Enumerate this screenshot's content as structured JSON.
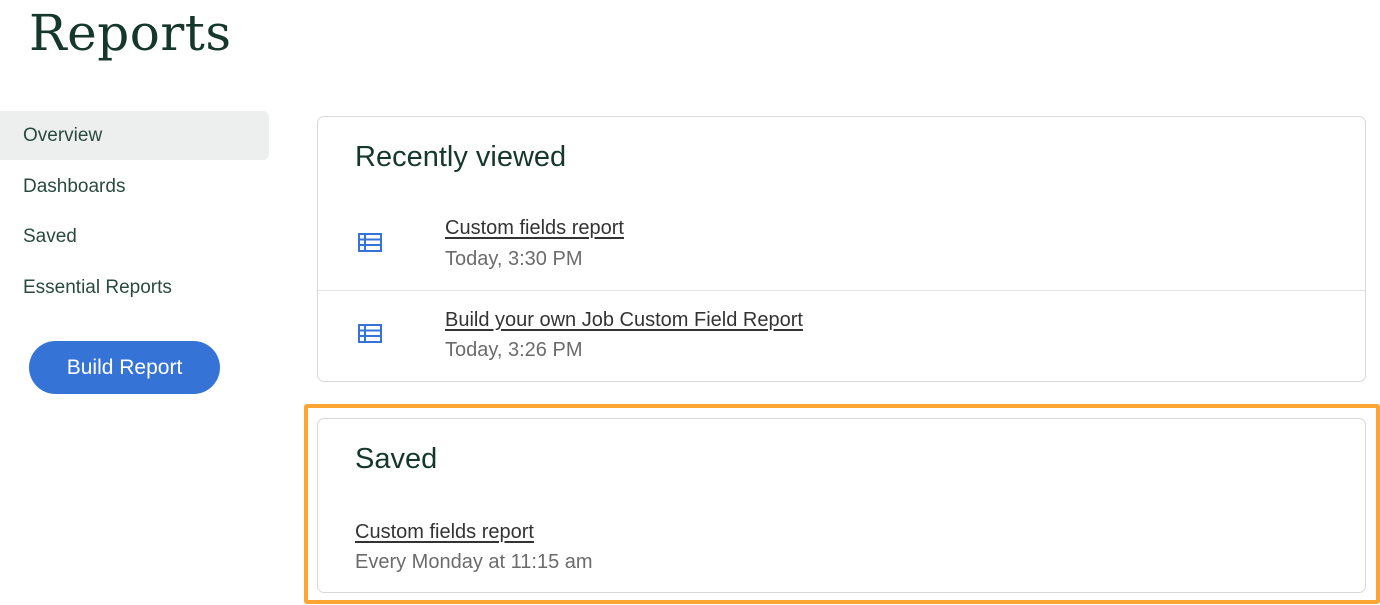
{
  "page": {
    "title": "Reports"
  },
  "sidebar": {
    "items": [
      {
        "label": "Overview",
        "active": true
      },
      {
        "label": "Dashboards",
        "active": false
      },
      {
        "label": "Saved",
        "active": false
      },
      {
        "label": "Essential Reports",
        "active": false
      }
    ],
    "build_button": "Build Report"
  },
  "recently_viewed": {
    "title": "Recently viewed",
    "items": [
      {
        "icon": "table-icon",
        "name": "Custom fields report",
        "time": "Today, 3:30 PM"
      },
      {
        "icon": "table-icon",
        "name": "Build your own Job Custom Field Report",
        "time": "Today, 3:26 PM"
      }
    ]
  },
  "saved": {
    "title": "Saved",
    "items": [
      {
        "name": "Custom fields report",
        "schedule": "Every Monday at 11:15 am"
      }
    ]
  },
  "colors": {
    "brand_dark_green": "#15372c",
    "primary_blue": "#3574d6",
    "highlight_orange": "#fca532",
    "active_nav_bg": "#ecefee"
  }
}
